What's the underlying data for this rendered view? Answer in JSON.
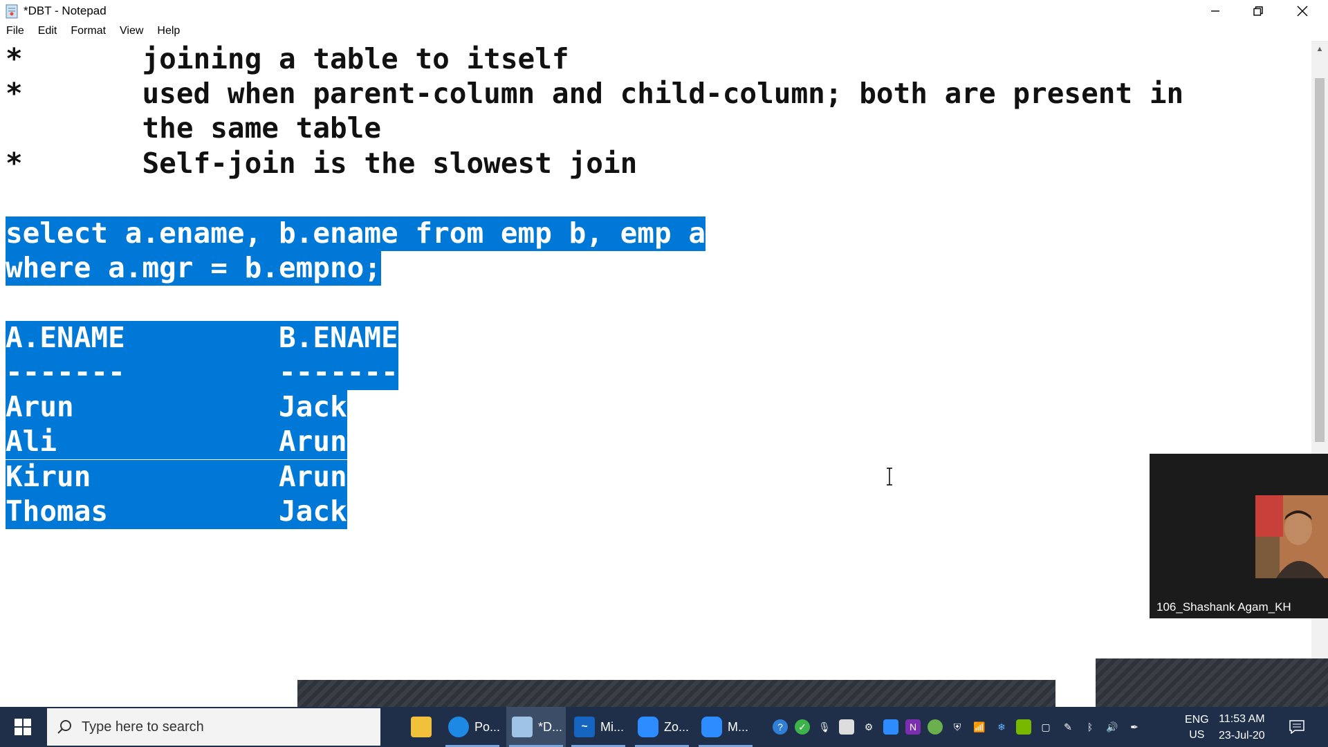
{
  "window": {
    "title": "*DBT - Notepad",
    "icon": "notepad-icon",
    "controls": [
      "minimize-icon",
      "restore-icon",
      "close-icon"
    ]
  },
  "menu": {
    "file": "File",
    "edit": "Edit",
    "format": "Format",
    "view": "View",
    "help": "Help"
  },
  "editor": {
    "lines": [
      {
        "text": "*       joining a table to itself",
        "selected": false
      },
      {
        "text": "*       used when parent-column and child-column; both are present in",
        "selected": false
      },
      {
        "text": "        the same table",
        "selected": false
      },
      {
        "text": "*       Self-join is the slowest join",
        "selected": false
      },
      {
        "text": "select a.ename, b.ename from emp b, emp a",
        "selected": true
      },
      {
        "text": "where a.mgr = b.empno;",
        "selected": true
      },
      {
        "text": "A.ENAME         B.ENAME",
        "selected": true
      },
      {
        "text": "-------         -------",
        "selected": true
      },
      {
        "text": "Arun            Jack",
        "selected": true
      },
      {
        "text": "Ali             Arun",
        "selected": true
      },
      {
        "text": "Kirun           Arun",
        "selected": true
      },
      {
        "text": "Thomas          Jack",
        "selected": true
      }
    ],
    "selection_color": "#0078d7"
  },
  "video_overlay": {
    "participant_name": "106_Shashank Agam_KH"
  },
  "taskbar": {
    "search_placeholder": "Type here to search",
    "apps": [
      {
        "label": "Po...",
        "icon": "edge-icon",
        "color": "#1e88e5"
      },
      {
        "label": "*D...",
        "icon": "notepad-icon",
        "color": "#9fc3e6",
        "active": true
      },
      {
        "label": "Mi...",
        "icon": "whiteboard-icon",
        "color": "#1565c0"
      },
      {
        "label": "Zo...",
        "icon": "zoom-icon",
        "color": "#2d8cff"
      },
      {
        "label": "M...",
        "icon": "zoom-meeting-icon",
        "color": "#2d8cff"
      }
    ],
    "language": {
      "line1": "ENG",
      "line2": "US"
    },
    "clock": {
      "time": "11:53 AM",
      "date": "23-Jul-20"
    }
  }
}
